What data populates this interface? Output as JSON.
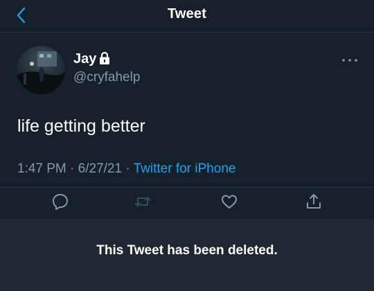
{
  "header": {
    "title": "Tweet",
    "back_icon": "chevron-left-icon"
  },
  "colors": {
    "background": "#15202b",
    "accent": "#1da1f2",
    "secondary_text": "#8899a6",
    "deleted_panel": "#1e2732"
  },
  "tweet": {
    "author": {
      "name": "Jay",
      "handle": "@cryfahelp",
      "protected_icon": "lock-icon",
      "avatar_icon": "avatar-image"
    },
    "text": "life getting better",
    "time": "1:47 PM",
    "date": "6/27/21",
    "separator": "·",
    "source": "Twitter for iPhone",
    "more_icon": "more-dots-icon"
  },
  "actions": [
    {
      "name": "reply",
      "icon": "reply-bubble-icon"
    },
    {
      "name": "retweet",
      "icon": "retweet-icon"
    },
    {
      "name": "like",
      "icon": "heart-icon"
    },
    {
      "name": "share",
      "icon": "share-icon"
    }
  ],
  "deleted_notice": {
    "text": "This Tweet has been deleted."
  }
}
